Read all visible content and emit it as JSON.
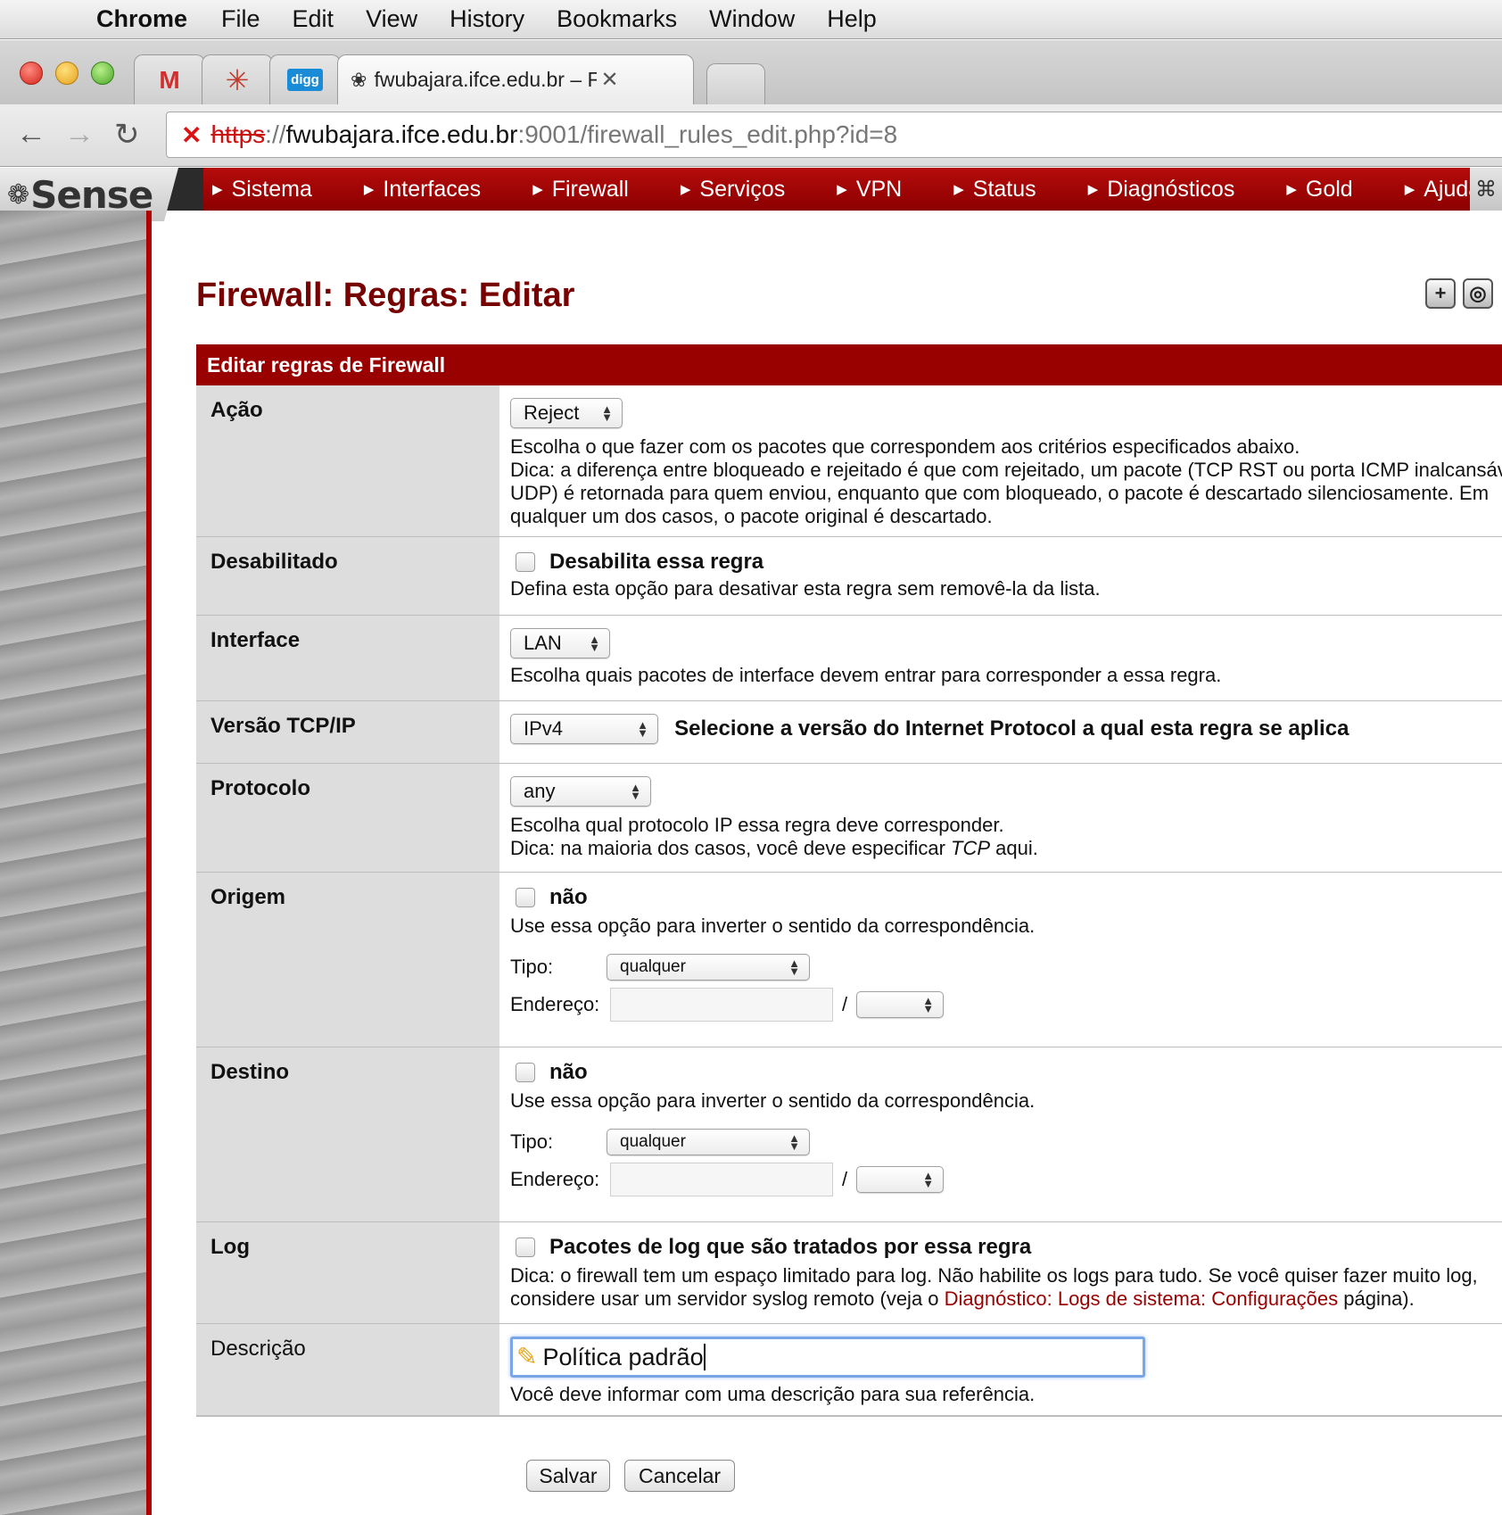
{
  "menubar": {
    "app": "Chrome",
    "items": [
      "File",
      "Edit",
      "View",
      "History",
      "Bookmarks",
      "Window",
      "Help"
    ]
  },
  "browser": {
    "active_tab_title": "fwubajara.ifce.edu.br – Fire",
    "tab_icons": [
      "gmail-icon",
      "star-icon",
      "digg-icon"
    ],
    "digg_label": "digg",
    "url_scheme": "https",
    "url_sep": "://",
    "url_host": "fwubajara.ifce.edu.br",
    "url_rest": ":9001/firewall_rules_edit.php?id=8"
  },
  "pfsense": {
    "logo": "Sense",
    "nav": [
      "Sistema",
      "Interfaces",
      "Firewall",
      "Serviços",
      "VPN",
      "Status",
      "Diagnósticos",
      "Gold",
      "Ajuda"
    ]
  },
  "page": {
    "title": "Firewall: Regras: Editar",
    "form_header": "Editar regras de Firewall"
  },
  "form": {
    "acao": {
      "label": "Ação",
      "value": "Reject",
      "help1": "Escolha o que fazer com os pacotes que correspondem aos critérios especificados abaixo.",
      "help2": "Dica: a diferença entre bloqueado e rejeitado é que com rejeitado, um pacote (TCP RST ou porta ICMP inalcansáve",
      "help3": "UDP) é retornada para quem enviou, enquanto que com bloqueado, o pacote é descartado silenciosamente. Em",
      "help4": "qualquer um dos casos, o pacote original é descartado."
    },
    "desabilitado": {
      "label": "Desabilitado",
      "checkbox_label": "Desabilita essa regra",
      "help": "Defina esta opção para desativar esta regra sem removê-la da lista."
    },
    "interface": {
      "label": "Interface",
      "value": "LAN",
      "help": "Escolha quais pacotes de interface devem entrar para corresponder a essa regra."
    },
    "versao": {
      "label": "Versão TCP/IP",
      "value": "IPv4",
      "help": "Selecione a versão do Internet Protocol a qual esta regra se aplica"
    },
    "protocolo": {
      "label": "Protocolo",
      "value": "any",
      "help1": "Escolha qual protocolo IP essa regra deve corresponder.",
      "help2a": "Dica: na maioria dos casos, você deve especificar ",
      "help2b": "TCP",
      "help2c": " aqui."
    },
    "origem": {
      "label": "Origem",
      "checkbox_label": "não",
      "help": "Use essa opção para inverter o sentido da correspondência.",
      "tipo_label": "Tipo:",
      "tipo_value": "qualquer",
      "endereco_label": "Endereço:",
      "slash": "/"
    },
    "destino": {
      "label": "Destino",
      "checkbox_label": "não",
      "help": "Use essa opção para inverter o sentido da correspondência.",
      "tipo_label": "Tipo:",
      "tipo_value": "qualquer",
      "endereco_label": "Endereço:",
      "slash": "/"
    },
    "log": {
      "label": "Log",
      "checkbox_label": "Pacotes de log que são tratados por essa regra",
      "help1": "Dica: o firewall tem um espaço limitado para log. Não habilite os logs para tudo. Se você quiser fazer muito log,",
      "help2a": "considere usar um servidor syslog remoto (veja o ",
      "help2_link": "Diagnóstico: Logs de sistema: Configurações",
      "help2b": " página)."
    },
    "descricao": {
      "label": "Descrição",
      "value": "Política padrão",
      "help": "Você deve informar com uma descrição para sua referência."
    }
  },
  "buttons": {
    "save": "Salvar",
    "cancel": "Cancelar"
  }
}
